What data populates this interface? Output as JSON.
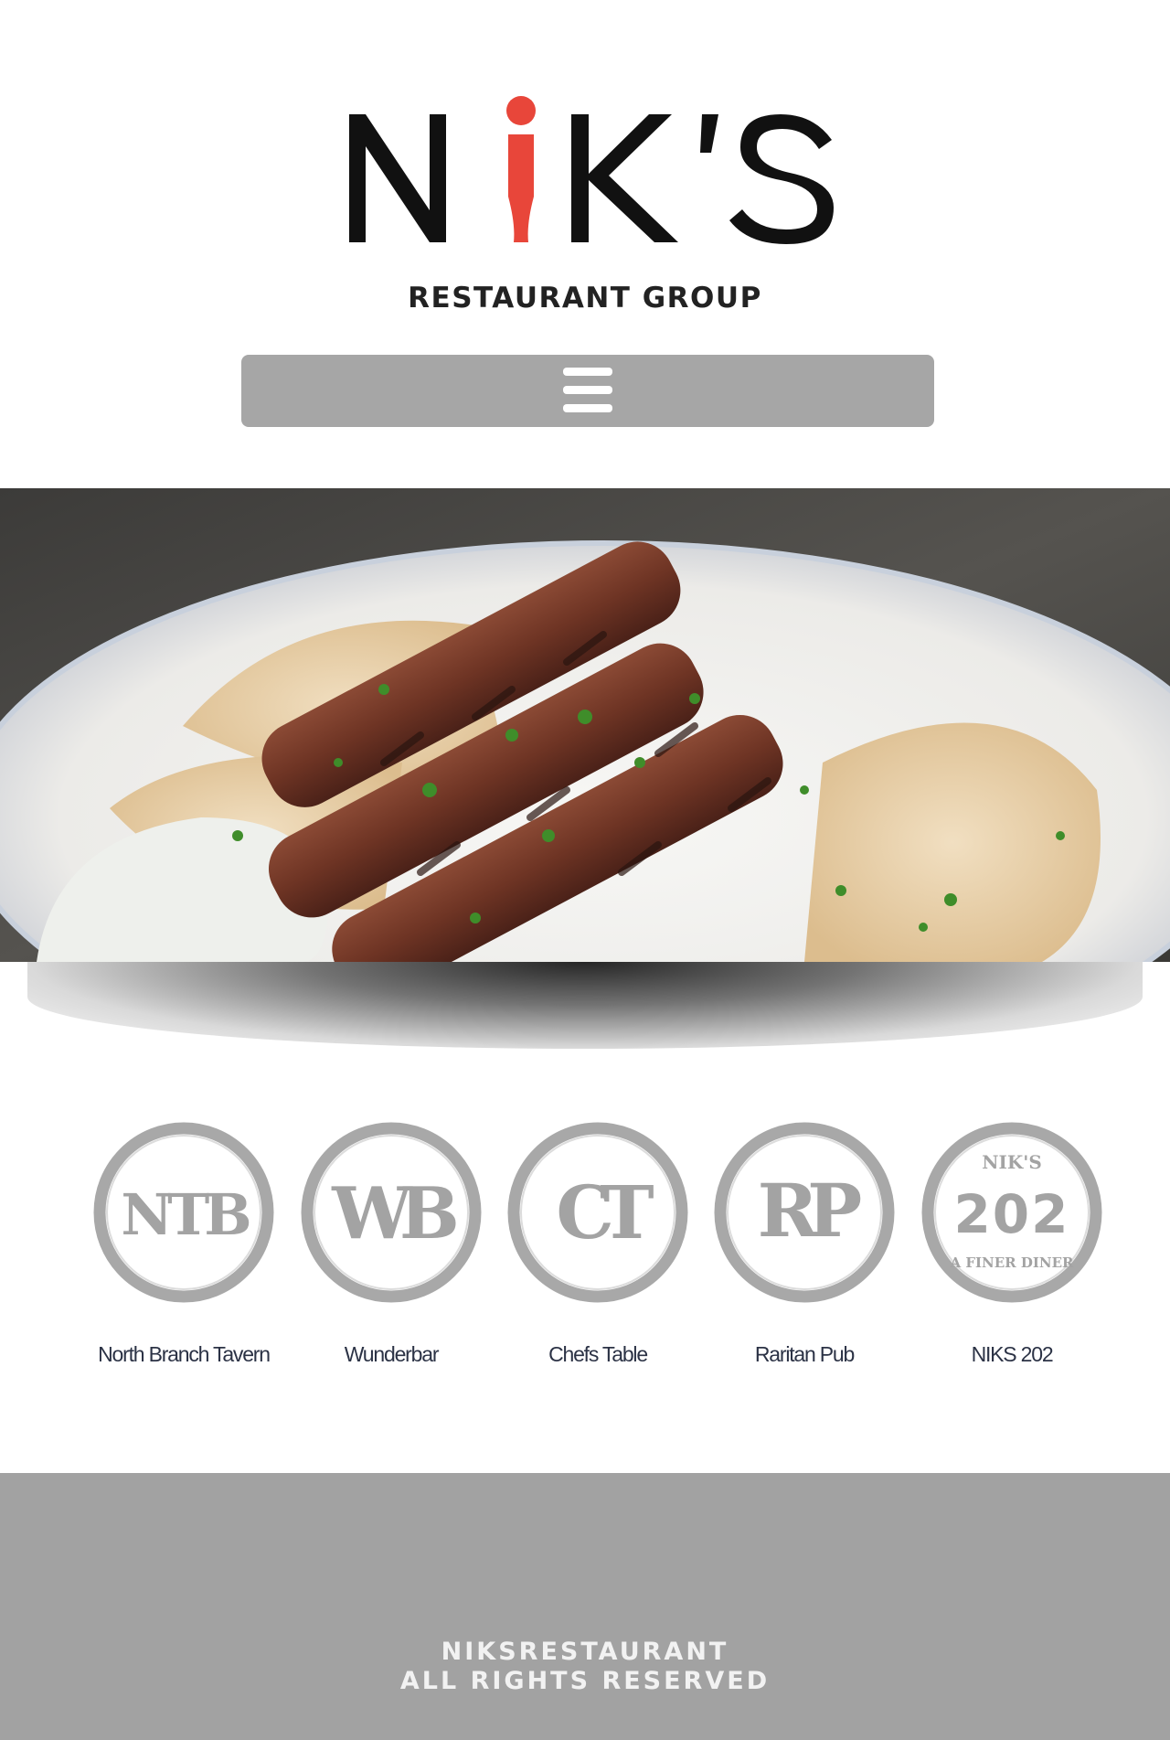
{
  "brand": {
    "wordmark": "NiK'S",
    "tagline": "RESTAURANT GROUP",
    "colors": {
      "black": "#111111",
      "accent_red": "#e8463a"
    }
  },
  "nav": {
    "icon": "hamburger-menu-icon",
    "color": "#a6a6a6"
  },
  "hero": {
    "subject": "grilled souvlaki skewers on pita with tzatziki"
  },
  "restaurants": [
    {
      "monogram": "NTB",
      "label": "North Branch Tavern"
    },
    {
      "monogram": "WB",
      "label": "Wunderbar"
    },
    {
      "monogram": "CT",
      "label": "Chefs Table"
    },
    {
      "monogram": "RP",
      "label": "Raritan Pub"
    },
    {
      "monogram_top": "NIK'S",
      "monogram": "202",
      "monogram_bottom": "A FINER DINER",
      "label": "NIKS 202"
    }
  ],
  "footer": {
    "line1": "NIKSRESTAURANT",
    "line2": "ALL RIGHTS RESERVED",
    "color": "#a2a2a2"
  }
}
